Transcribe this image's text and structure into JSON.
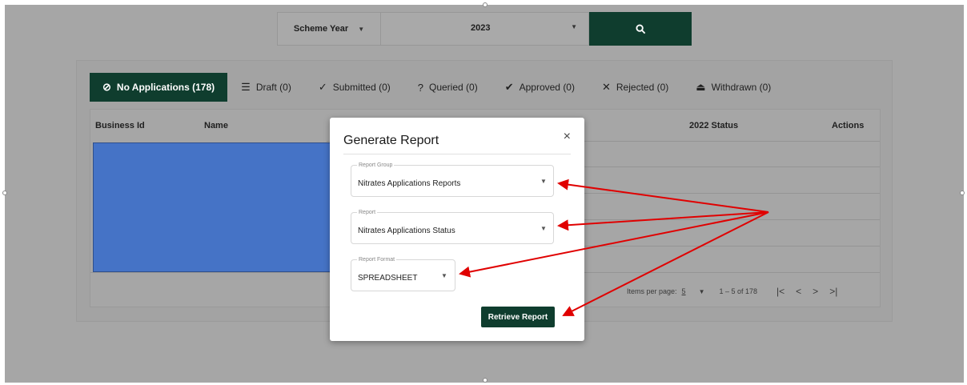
{
  "filter": {
    "scheme_label": "Scheme Year",
    "year_value": "2023"
  },
  "tabs": [
    {
      "label": "No Applications (178)",
      "icon": "circle-slash-icon"
    },
    {
      "label": "Draft (0)",
      "icon": "lines-icon"
    },
    {
      "label": "Submitted (0)",
      "icon": "check-icon"
    },
    {
      "label": "Queried (0)",
      "icon": "question-circle-icon"
    },
    {
      "label": "Approved (0)",
      "icon": "double-check-icon"
    },
    {
      "label": "Rejected (0)",
      "icon": "x-icon"
    },
    {
      "label": "Withdrawn (0)",
      "icon": "eject-icon"
    }
  ],
  "table": {
    "headers": {
      "business_id": "Business Id",
      "name": "Name",
      "status_2022": "2022 Status",
      "actions": "Actions"
    }
  },
  "paginator": {
    "items_per_page_label": "Items per page:",
    "page_size": "5",
    "range": "1 – 5 of 178",
    "first": "|<",
    "prev": "<",
    "next": ">",
    "last": ">|"
  },
  "modal": {
    "title": "Generate Report",
    "close": "×",
    "report_group": {
      "label": "Report Group",
      "value": "Nitrates Applications Reports"
    },
    "report": {
      "label": "Report",
      "value": "Nitrates Applications Status"
    },
    "report_format": {
      "label": "Report Format",
      "value": "SPREADSHEET"
    },
    "retrieve_label": "Retrieve Report"
  },
  "colors": {
    "brand_green": "#0f3d2e",
    "arrow_red": "#e00000",
    "redaction_blue": "#4573c6",
    "overlay_gray": "#a6a6a6"
  }
}
